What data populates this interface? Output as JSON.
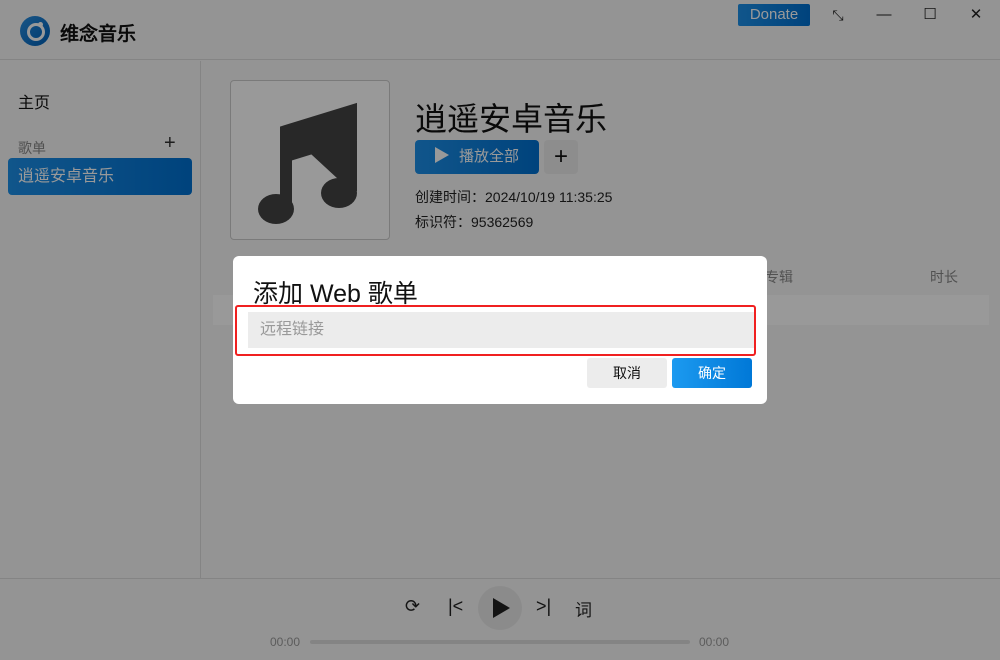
{
  "app": {
    "name": "维念音乐",
    "donate": "Donate",
    "icons": [
      "fullscreen-exit-icon",
      "minimize-icon",
      "maximize-icon",
      "close-icon"
    ]
  },
  "sidebar": {
    "home": "主页",
    "section": "歌单",
    "add": "+",
    "items": [
      {
        "label": "逍遥安卓音乐",
        "active": true
      }
    ]
  },
  "playlist": {
    "title": "逍遥安卓音乐",
    "play_all": "播放全部",
    "add": "+",
    "created_label": "创建时间：",
    "created": "2024/10/19 11:35:25",
    "id_label": "标识符：",
    "id": "95362569"
  },
  "table": {
    "columns": [
      "专辑",
      "时长"
    ]
  },
  "player": {
    "lyrics": "词",
    "current": "00:00",
    "total": "00:00",
    "progress": 0
  },
  "dialog": {
    "title": "添加 Web 歌单",
    "placeholder": "远程链接",
    "value": "",
    "cancel": "取消",
    "confirm": "确定"
  },
  "colors": {
    "accent": "#0078d7",
    "highlight": "#f02020"
  }
}
